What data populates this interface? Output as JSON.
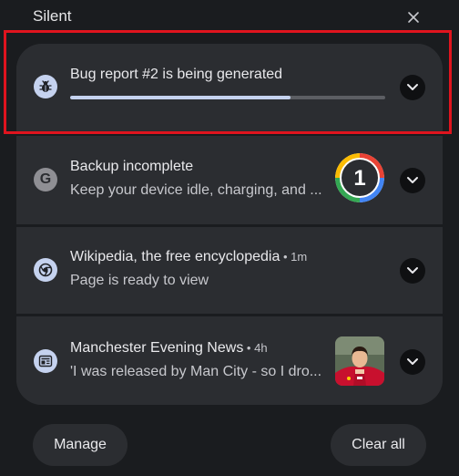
{
  "header": {
    "title": "Silent"
  },
  "notifications": [
    {
      "title": "Bug report #2 is being generated",
      "icon": "bug-icon",
      "progress": 0.7
    },
    {
      "title": "Backup incomplete",
      "text": "Keep your device idle, charging, and ...",
      "icon": "google-g-icon",
      "thumbnail": "google-one-logo",
      "thumbnail_label": "1"
    },
    {
      "title": "Wikipedia, the free encyclopedia",
      "time": "1m",
      "text": "Page is ready to view",
      "icon": "chrome-icon"
    },
    {
      "title": "Manchester Evening News",
      "time": "4h",
      "text": "'I was released by Man City - so I dro...",
      "icon": "news-icon",
      "thumbnail": "football-player-photo"
    }
  ],
  "footer": {
    "manage_label": "Manage",
    "clear_all_label": "Clear all"
  },
  "colors": {
    "background": "#1a1c1f",
    "card": "#2b2d31",
    "accent": "#c5d2ef",
    "highlight": "#e0141e"
  }
}
